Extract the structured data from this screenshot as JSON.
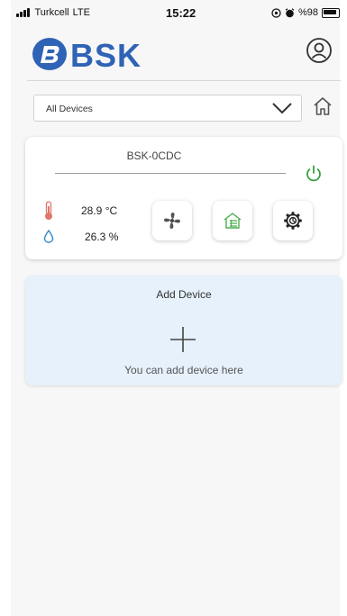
{
  "status_bar": {
    "carrier": "Turkcell",
    "network": "LTE",
    "time": "15:22",
    "battery": "%98"
  },
  "header": {
    "logo_text": "BSK"
  },
  "device_selector": {
    "selected": "All Devices"
  },
  "device_card": {
    "name": "BSK-0CDC",
    "temperature": "28.9 °C",
    "humidity": "26.3 %",
    "power_color": "#2e9d3a"
  },
  "add_device": {
    "title": "Add Device",
    "subtitle": "You can add device here"
  },
  "colors": {
    "brand": "#2f63b5",
    "add_card_bg": "#e6f1fb",
    "thermometer": "#e0776b",
    "droplet": "#2a86c9"
  }
}
